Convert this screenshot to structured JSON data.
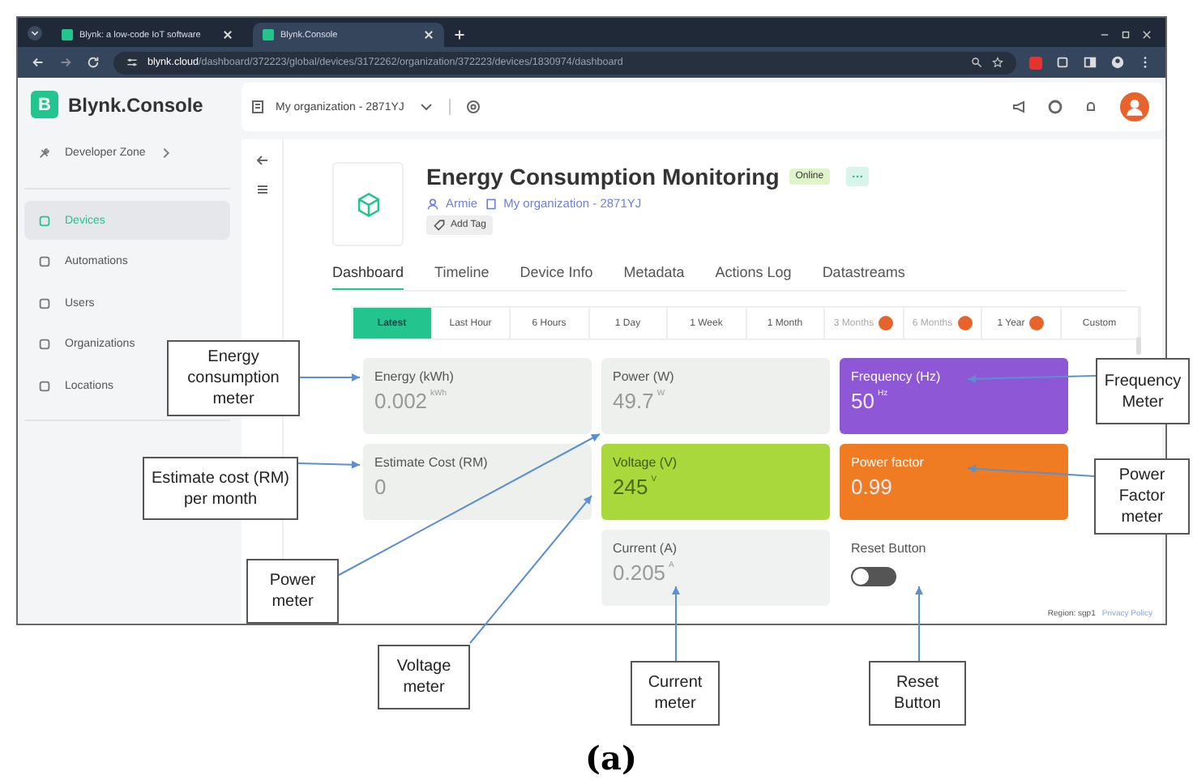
{
  "browser": {
    "tabs": [
      {
        "title": "Blynk: a low-code IoT software",
        "selected": false
      },
      {
        "title": "Blynk.Console",
        "selected": true
      }
    ],
    "url_host": "blynk.cloud",
    "url_path": "/dashboard/372223/global/devices/3172262/organization/372223/devices/1830974/dashboard"
  },
  "app": {
    "logo_letter": "B",
    "logo_text": "Blynk.Console",
    "organization": "My organization - 2871YJ",
    "sidebar": [
      {
        "label": "Developer Zone",
        "kind": "group",
        "selected": false
      },
      {
        "label": "Devices",
        "kind": "item",
        "selected": true
      },
      {
        "label": "Automations",
        "kind": "item",
        "selected": false
      },
      {
        "label": "Users",
        "kind": "item",
        "selected": false
      },
      {
        "label": "Organizations",
        "kind": "item",
        "selected": false
      },
      {
        "label": "Locations",
        "kind": "item",
        "selected": false
      }
    ],
    "device": {
      "name": "Energy Consumption Monitoring",
      "status": "Online",
      "owner": "Armie",
      "organization": "My organization - 2871YJ",
      "tag_button": "Add Tag"
    },
    "tabs": [
      {
        "label": "Dashboard",
        "selected": true
      },
      {
        "label": "Timeline",
        "selected": false
      },
      {
        "label": "Device Info",
        "selected": false
      },
      {
        "label": "Metadata",
        "selected": false
      },
      {
        "label": "Actions Log",
        "selected": false
      },
      {
        "label": "Datastreams",
        "selected": false
      }
    ],
    "ranges": [
      {
        "label": "Latest",
        "selected": true,
        "badge": false
      },
      {
        "label": "Last Hour",
        "selected": false,
        "badge": false
      },
      {
        "label": "6 Hours",
        "selected": false,
        "badge": false
      },
      {
        "label": "1 Day",
        "selected": false,
        "badge": false
      },
      {
        "label": "1 Week",
        "selected": false,
        "badge": false
      },
      {
        "label": "1 Month",
        "selected": false,
        "badge": false
      },
      {
        "label": "3 Months",
        "selected": false,
        "badge": true
      },
      {
        "label": "6 Months",
        "selected": false,
        "badge": true
      },
      {
        "label": "1 Year",
        "selected": false,
        "badge": true
      },
      {
        "label": "Custom",
        "selected": false,
        "badge": false
      }
    ],
    "widget_rows": [
      [
        {
          "kind": "value",
          "title": "Energy (kWh)",
          "value": "0.002",
          "unit": "kWh",
          "color": "#eef0ee"
        },
        {
          "kind": "value",
          "title": "Power (W)",
          "value": "49.7",
          "unit": "W",
          "color": "#eef0ee"
        },
        {
          "kind": "value",
          "title": "Frequency (Hz)",
          "value": "50",
          "unit": "Hz",
          "color": "#8e57d6"
        }
      ],
      [
        {
          "kind": "value",
          "title": "Estimate Cost (RM)",
          "value": "0",
          "color": "#eef0ee"
        },
        {
          "kind": "value",
          "title": "Voltage (V)",
          "value": "245",
          "unit": "V",
          "color": "#a8d83c"
        },
        {
          "kind": "value",
          "title": "Power factor",
          "value": "0.99",
          "color": "#ef7b22"
        }
      ],
      [
        {
          "kind": "value",
          "title": "Current (A)",
          "value": "0.205",
          "unit": "A",
          "color": "#f0f1f1"
        },
        {
          "kind": "switch",
          "title": "Reset Button",
          "on": false,
          "color": "#ffffff"
        }
      ]
    ],
    "region": "Region: sgp1",
    "privacy": "Privacy Policy"
  },
  "annotations": [
    {
      "text": "Energy consumption meter"
    },
    {
      "text": "Frequency Meter"
    },
    {
      "text": "Estimate cost (RM) per month"
    },
    {
      "text": "Power Factor meter"
    },
    {
      "text": "Power meter"
    },
    {
      "text": "Voltage meter"
    },
    {
      "text": "Current meter"
    },
    {
      "text": "Reset Button"
    }
  ],
  "caption": "(a)"
}
